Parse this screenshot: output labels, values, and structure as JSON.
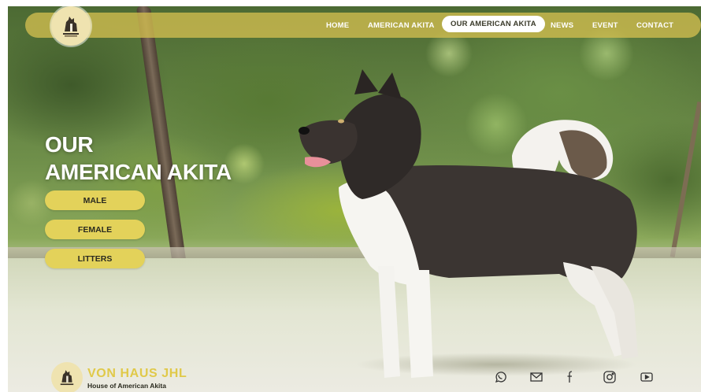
{
  "nav": {
    "links": [
      "HOME",
      "AMERICAN AKITA",
      "OUR AMERICAN AKITA",
      "NEWS",
      "EVENT",
      "CONTACT"
    ],
    "active": "OUR AMERICAN AKITA"
  },
  "hero": {
    "title_line1": "OUR",
    "title_line2": "AMERICAN AKITA",
    "buttons": [
      "MALE",
      "FEMALE",
      "LITTERS"
    ]
  },
  "footer": {
    "brand_name": "VON HAUS JHL",
    "tagline": "House of American Akita",
    "social_icons": [
      "whatsapp-icon",
      "mail-icon",
      "facebook-icon",
      "instagram-icon",
      "youtube-icon"
    ]
  },
  "colors": {
    "accent_yellow": "#e3d25a",
    "brand_gold": "#e0c949",
    "nav_bar": "#d2be50"
  }
}
